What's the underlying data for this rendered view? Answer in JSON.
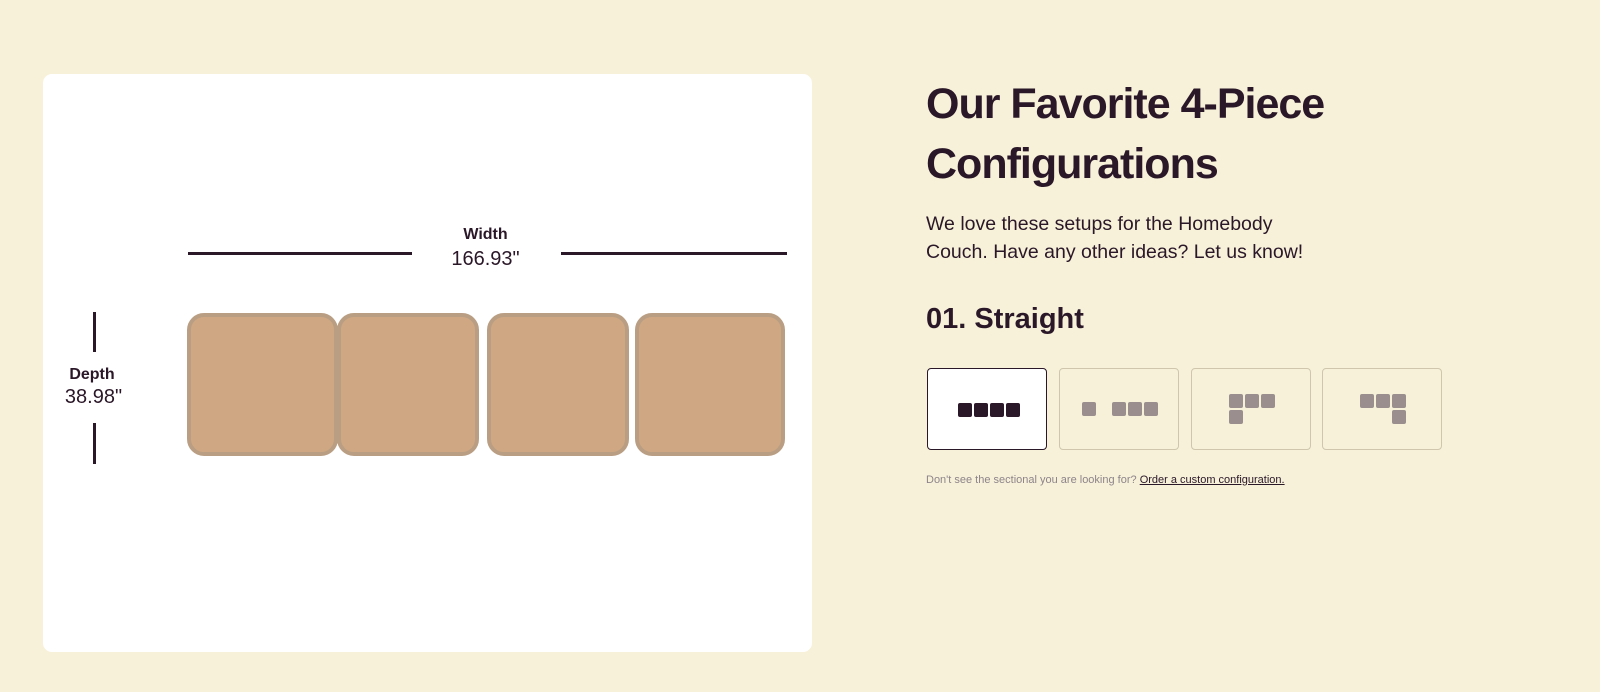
{
  "heading": "Our Favorite 4-Piece Configurations",
  "subtext": "We love these setups for the Homebody Couch. Have any other ideas? Let us know!",
  "config_title": "01. Straight",
  "preview": {
    "width_label": "Width",
    "width_value": "166.93\"",
    "depth_label": "Depth",
    "depth_value": "38.98\""
  },
  "options": [
    {
      "name": "straight",
      "selected": true
    },
    {
      "name": "split",
      "selected": false
    },
    {
      "name": "sectional-left",
      "selected": false
    },
    {
      "name": "sectional-right",
      "selected": false
    }
  ],
  "note": {
    "text": "Don't see the sectional you are looking for? ",
    "link": "Order a custom configuration."
  },
  "colors": {
    "background": "#f7f1d9",
    "text": "#2a1728",
    "seat_fill": "#cfa883",
    "seat_border": "#b99e83",
    "icon_active": "#2a1728",
    "icon_inactive": "#9a8f8e"
  }
}
